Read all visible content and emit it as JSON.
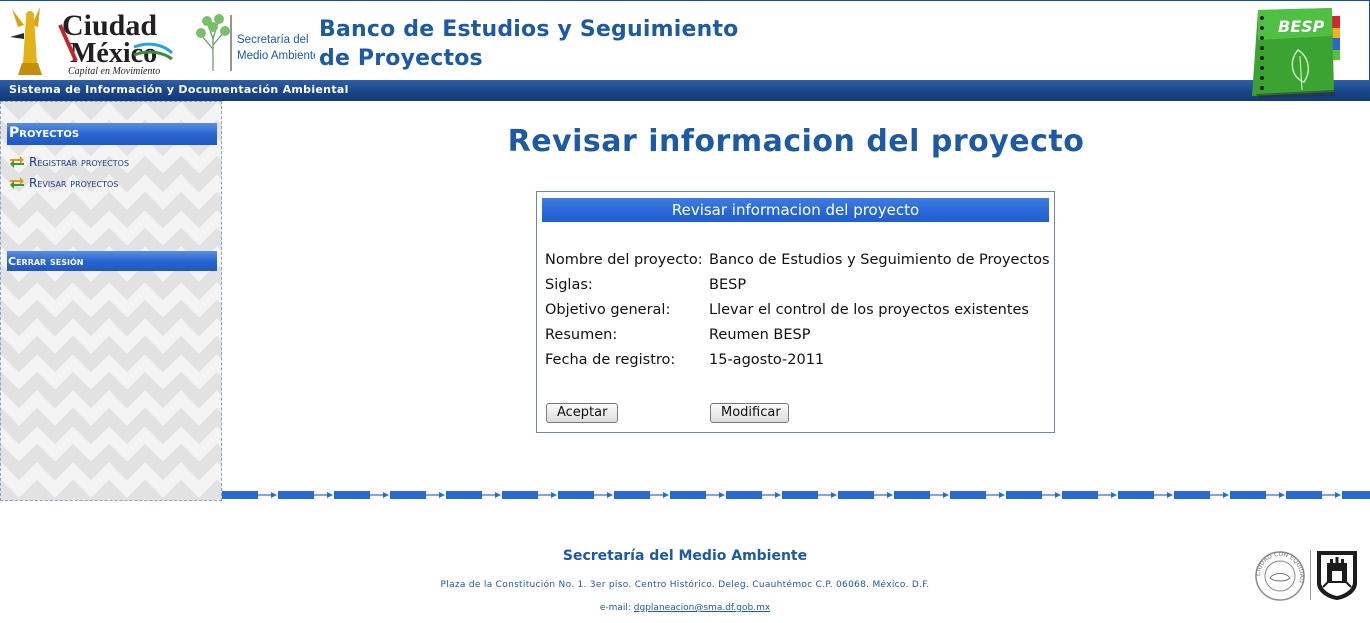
{
  "header": {
    "cdmx_logo_text": {
      "line1": "Ciudad",
      "line2": "México",
      "tagline": "Capital en Movimiento"
    },
    "sma_logo_text": {
      "line1": "Secretaría del",
      "line2": "Medio Ambiente"
    },
    "title": "Banco de Estudios y Seguimiento de Proyectos",
    "besp_logo": "BESP",
    "subtitle": "Sistema de Información y Documentación Ambiental"
  },
  "sidebar": {
    "projects_header": "Proyectos",
    "items": [
      {
        "label": "Registrar proyectos",
        "icon": "swap-arrows-icon"
      },
      {
        "label": "Revisar proyectos",
        "icon": "swap-arrows-icon"
      }
    ],
    "logout": "Cerrar sesión"
  },
  "main": {
    "page_title": "Revisar informacion del proyecto",
    "panel": {
      "header": "Revisar informacion del proyecto",
      "fields": [
        {
          "label": "Nombre del proyecto:",
          "value": "Banco de Estudios y Seguimiento de Proyectos"
        },
        {
          "label": "Siglas:",
          "value": "BESP"
        },
        {
          "label": "Objetivo general:",
          "value": "Llevar el control de los proyectos existentes"
        },
        {
          "label": "Resumen:",
          "value": "Reumen BESP"
        },
        {
          "label": "Fecha de registro:",
          "value": "15-agosto-2011"
        }
      ],
      "accept_label": "Aceptar",
      "modify_label": "Modificar"
    }
  },
  "footer": {
    "title": "Secretaría del Medio Ambiente",
    "address": "Plaza de la Constitución No. 1. 3er piso. Centro Histórico. Deleg. Cuauhtémoc C.P. 06068. México. D.F.",
    "email_prefix": "e-mail:",
    "email": "dgplaneacion@sma.df.gob.mx",
    "seal_text": "CIUDAD CON EQUIDAD"
  },
  "colors": {
    "brand_blue": "#1d5aa3",
    "bar_blue": "#1a468a",
    "header_gradient": "#2a66d0"
  }
}
